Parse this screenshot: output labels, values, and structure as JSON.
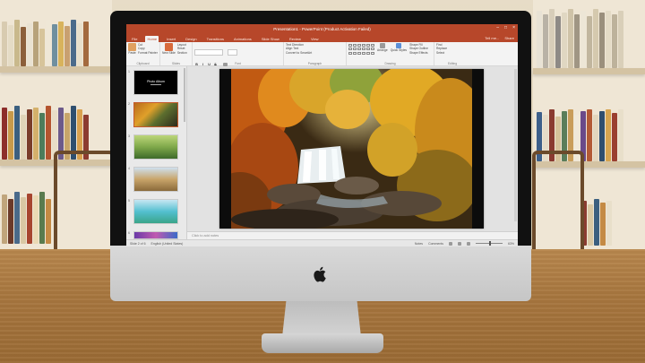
{
  "window": {
    "title": "Presentation1 - PowerPoint (Product Activation Failed)",
    "minimize_icon": "minimize-icon",
    "maximize_icon": "maximize-icon",
    "close_icon": "close-icon"
  },
  "ribbon_tabs": [
    {
      "label": "File"
    },
    {
      "label": "Home",
      "active": true
    },
    {
      "label": "Insert"
    },
    {
      "label": "Design"
    },
    {
      "label": "Transitions"
    },
    {
      "label": "Animations"
    },
    {
      "label": "Slide Show"
    },
    {
      "label": "Review"
    },
    {
      "label": "View"
    }
  ],
  "tabs_right": {
    "tell_me": "Tell me...",
    "share": "Share"
  },
  "ribbon": {
    "clipboard": {
      "paste": "Paste",
      "cut": "Cut",
      "copy": "Copy",
      "format_painter": "Format Painter",
      "label": "Clipboard"
    },
    "slides": {
      "new_slide": "New Slide",
      "layout": "Layout",
      "reset": "Reset",
      "section": "Section",
      "label": "Slides"
    },
    "font": {
      "label": "Font",
      "bold": "B",
      "italic": "I",
      "underline": "U",
      "strike": "S"
    },
    "paragraph": {
      "text_direction": "Text Direction",
      "align_text": "Align Text",
      "smartart": "Convert to SmartArt",
      "label": "Paragraph"
    },
    "drawing": {
      "arrange": "Arrange",
      "quick_styles": "Quick Styles",
      "shape_fill": "Shape Fill",
      "shape_outline": "Shape Outline",
      "shape_effects": "Shape Effects",
      "label": "Drawing"
    },
    "editing": {
      "find": "Find",
      "replace": "Replace",
      "select": "Select",
      "label": "Editing"
    }
  },
  "slides_panel": {
    "thumbnails": [
      {
        "number": "1",
        "title": "Photo Album"
      },
      {
        "number": "2"
      },
      {
        "number": "3"
      },
      {
        "number": "4"
      },
      {
        "number": "5"
      },
      {
        "number": "6"
      }
    ]
  },
  "notes": {
    "placeholder": "Click to add notes"
  },
  "statusbar": {
    "slide_info": "Slide 2 of 6",
    "language": "English (United States)",
    "notes_btn": "Notes",
    "comments_btn": "Comments",
    "zoom": "63%"
  },
  "colors": {
    "accent": "#b7472a"
  }
}
